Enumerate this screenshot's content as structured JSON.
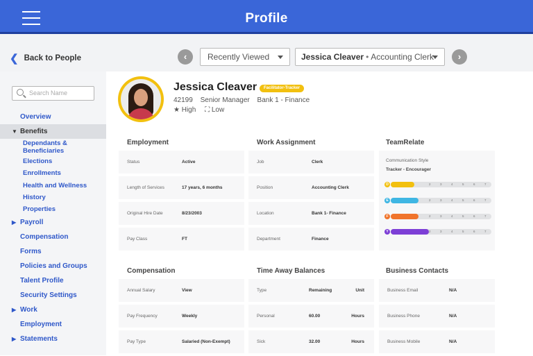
{
  "header": {
    "title": "Profile"
  },
  "subbar": {
    "back_label": "Back to People",
    "recent_label": "Recently Viewed",
    "person_name": "Jessica Cleaver",
    "person_role": "Accounting Clerk",
    "prev_icon": "chevron-left-circle-icon",
    "next_icon": "chevron-right-circle-icon"
  },
  "sidebar": {
    "search_placeholder": "Search Name",
    "items": [
      {
        "label": "Overview",
        "type": "link"
      },
      {
        "label": "Benefits",
        "type": "expanded",
        "active": true
      },
      {
        "label": "Dependants & Beneficiaries",
        "type": "sub"
      },
      {
        "label": "Elections",
        "type": "sub"
      },
      {
        "label": "Enrollments",
        "type": "sub"
      },
      {
        "label": "Health and Wellness",
        "type": "sub"
      },
      {
        "label": "History",
        "type": "sub"
      },
      {
        "label": "Properties",
        "type": "sub"
      },
      {
        "label": "Payroll",
        "type": "collapsed"
      },
      {
        "label": "Compensation",
        "type": "link"
      },
      {
        "label": "Forms",
        "type": "link"
      },
      {
        "label": "Policies and Groups",
        "type": "link"
      },
      {
        "label": "Talent Profile",
        "type": "link"
      },
      {
        "label": "Security Settings",
        "type": "link"
      },
      {
        "label": "Work",
        "type": "collapsed"
      },
      {
        "label": "Employment",
        "type": "link"
      },
      {
        "label": "Statements",
        "type": "collapsed"
      }
    ]
  },
  "profile": {
    "name": "Jessica Cleaver",
    "badge": "Facilitator-Tracker",
    "employee_id": "42199",
    "title": "Senior Manager",
    "location": "Bank 1 - Finance",
    "flag1": "★ High",
    "flag2": "⛶ Low"
  },
  "employment": {
    "heading": "Employment",
    "rows": [
      {
        "k": "Status",
        "v": "Active"
      },
      {
        "k": "Length of Services",
        "v": "17 years, 6 months"
      },
      {
        "k": "Original Hire Date",
        "v": "8/23/2003"
      },
      {
        "k": "Pay Class",
        "v": "FT"
      }
    ]
  },
  "work_assignment": {
    "heading": "Work Assignment",
    "rows": [
      {
        "k": "Job",
        "v": "Clerk"
      },
      {
        "k": "Position",
        "v": "Accounting Clerk"
      },
      {
        "k": "Location",
        "v": "Bank 1- Finance"
      },
      {
        "k": "Department",
        "v": "Finance"
      }
    ]
  },
  "teamrelate": {
    "heading": "TeamRelate",
    "style_label": "Communication Style",
    "style_value": "Tracker - Encourager",
    "bars": [
      {
        "letter": "D",
        "color": "#f2c00f",
        "level": 2
      },
      {
        "letter": "E",
        "color": "#3fb6e3",
        "level": 3
      },
      {
        "letter": "F",
        "color": "#f0742c",
        "level": 3
      },
      {
        "letter": "Y",
        "color": "#7d3fd6",
        "level": 4
      }
    ],
    "ticks": [
      "2",
      "3",
      "4",
      "5",
      "6",
      "7"
    ]
  },
  "compensation": {
    "heading": "Compensation",
    "rows": [
      {
        "k": "Annual Salary",
        "v": "View"
      },
      {
        "k": "Pay Frequency",
        "v": "Weekly"
      },
      {
        "k": "Pay Type",
        "v": "Salaried (Non-Exempt)"
      }
    ]
  },
  "time_away": {
    "heading": "Time Away Balances",
    "header": {
      "k": "Type",
      "v": "Remaining",
      "u": "Unit"
    },
    "rows": [
      {
        "k": "Personal",
        "v": "60.00",
        "u": "Hours"
      },
      {
        "k": "Sick",
        "v": "32.00",
        "u": "Hours"
      }
    ]
  },
  "business_contacts": {
    "heading": "Business Contacts",
    "rows": [
      {
        "k": "Business Email",
        "v": "N/A"
      },
      {
        "k": "Business Phone",
        "v": "N/A"
      },
      {
        "k": "Business Mobile",
        "v": "N/A"
      }
    ]
  }
}
